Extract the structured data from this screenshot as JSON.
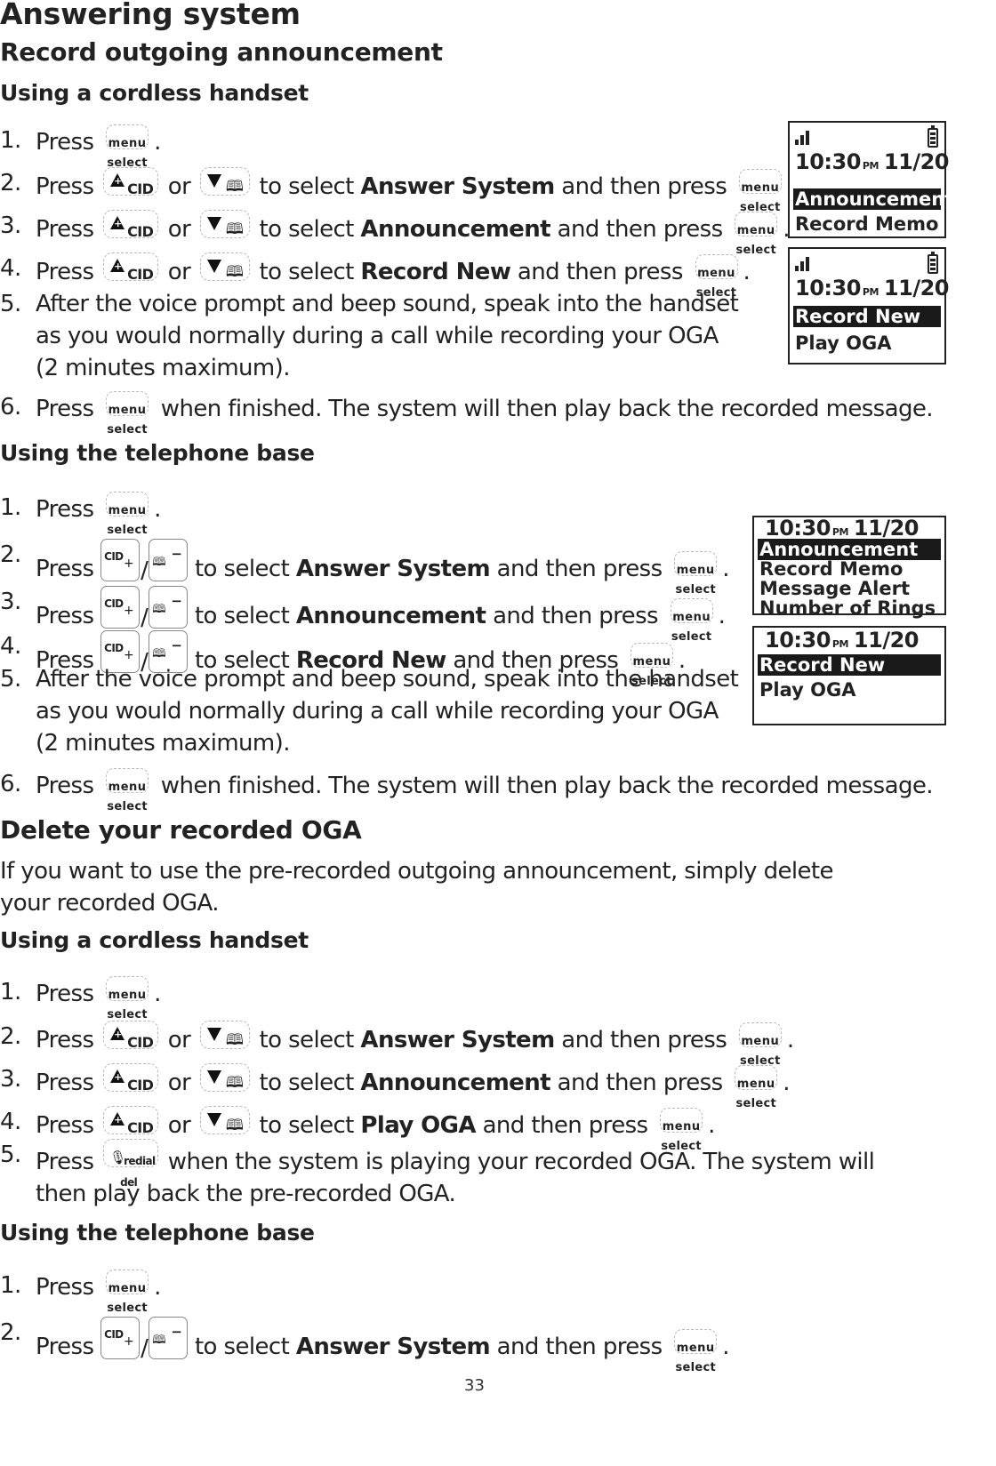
{
  "page": {
    "title": "Answering system",
    "page_number": "33"
  },
  "keys": {
    "menu": "menu",
    "select": "select",
    "cid": "CID",
    "redial": "redial",
    "del": "del",
    "plus": "+",
    "minus": "−"
  },
  "sections": {
    "record": {
      "heading": "Record outgoing announcement",
      "handset": {
        "heading": "Using a cordless handset",
        "steps": [
          {
            "num": "1.",
            "press": "Press",
            "tail": "."
          },
          {
            "num": "2.",
            "press": "Press",
            "or": "or",
            "pre": "to select",
            "item": "Answer System",
            "post": "and then press",
            "tail": "."
          },
          {
            "num": "3.",
            "press": "Press",
            "or": "or",
            "pre": "to select",
            "item": "Announcement",
            "post": "and then press",
            "tail": "."
          },
          {
            "num": "4.",
            "press": "Press",
            "or": "or",
            "pre": "to select",
            "item": "Record New",
            "post": "and then press",
            "tail": "."
          },
          {
            "num": "5.",
            "text": "After the voice prompt and beep sound, speak into the handset as you would normally during a call while recording your OGA (2 minutes maximum)."
          },
          {
            "num": "6.",
            "press": "Press",
            "post": "when finished. The system will then play back the recorded message."
          }
        ],
        "screens": [
          {
            "time": "10:30",
            "ampm": "PM",
            "date": "11/20",
            "rows": [
              {
                "label": "Announcement",
                "selected": true
              },
              {
                "label": "Record Memo",
                "selected": false
              }
            ]
          },
          {
            "time": "10:30",
            "ampm": "PM",
            "date": "11/20",
            "rows": [
              {
                "label": "Record New",
                "selected": true
              },
              {
                "label": "Play OGA",
                "selected": false
              }
            ]
          }
        ]
      },
      "base": {
        "heading": "Using the telephone base",
        "steps": [
          {
            "num": "1.",
            "press": "Press",
            "tail": "."
          },
          {
            "num": "2.",
            "press": "Press",
            "slash": "/",
            "pre": "to select",
            "item": "Answer System",
            "post": "and then press",
            "tail": "."
          },
          {
            "num": "3.",
            "press": "Press",
            "slash": "/",
            "pre": "to select",
            "item": "Announcement",
            "post": "and then press",
            "tail": "."
          },
          {
            "num": "4.",
            "press": "Press",
            "slash": "/",
            "pre": "to select",
            "item": "Record New",
            "post": "and then press",
            "tail": "."
          },
          {
            "num": "5.",
            "text": "After the voice prompt and beep sound, speak into the handset as you would normally during a call while recording your OGA (2 minutes maximum)."
          },
          {
            "num": "6.",
            "press": "Press",
            "post": "when finished. The system will then play back the recorded message."
          }
        ],
        "screens": [
          {
            "time": "10:30",
            "ampm": "PM",
            "date": "11/20",
            "rows": [
              {
                "label": "Announcement",
                "selected": true
              },
              {
                "label": "Record Memo",
                "selected": false
              },
              {
                "label": "Message Alert",
                "selected": false
              },
              {
                "label": "Number of Rings",
                "selected": false
              }
            ]
          },
          {
            "time": "10:30",
            "ampm": "PM",
            "date": "11/20",
            "rows": [
              {
                "label": "Record New",
                "selected": true
              },
              {
                "label": "Play OGA",
                "selected": false
              }
            ]
          }
        ]
      }
    },
    "delete": {
      "heading": "Delete your recorded OGA",
      "intro": "If you want to use the pre-recorded outgoing announcement, simply delete your recorded OGA.",
      "handset": {
        "heading": "Using a cordless handset",
        "steps": [
          {
            "num": "1.",
            "press": "Press",
            "tail": "."
          },
          {
            "num": "2.",
            "press": "Press",
            "or": "or",
            "pre": "to select",
            "item": "Answer System",
            "post": "and then press",
            "tail": "."
          },
          {
            "num": "3.",
            "press": "Press",
            "or": "or",
            "pre": "to select",
            "item": "Announcement",
            "post": "and then press",
            "tail": "."
          },
          {
            "num": "4.",
            "press": "Press",
            "or": "or",
            "pre": "to select",
            "item": "Play OGA",
            "post": "and then press",
            "tail": "."
          },
          {
            "num": "5.",
            "press": "Press",
            "post": "when the system is playing your recorded OGA. The system will then play back the pre-recorded OGA."
          }
        ]
      },
      "base": {
        "heading": "Using the telephone base",
        "steps": [
          {
            "num": "1.",
            "press": "Press",
            "tail": "."
          },
          {
            "num": "2.",
            "press": "Press",
            "slash": "/",
            "pre": "to select",
            "item": "Answer System",
            "post": "and then press",
            "tail": "."
          }
        ]
      }
    }
  }
}
